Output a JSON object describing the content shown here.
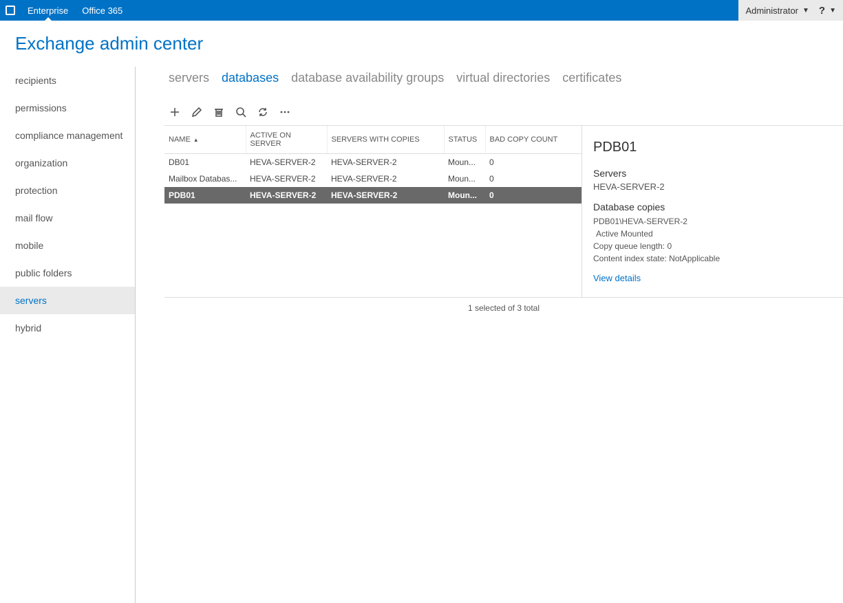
{
  "topbar": {
    "tabs": [
      {
        "label": "Enterprise",
        "active": true
      },
      {
        "label": "Office 365",
        "active": false
      }
    ],
    "user_label": "Administrator"
  },
  "page_title": "Exchange admin center",
  "sidebar": {
    "items": [
      {
        "label": "recipients",
        "active": false
      },
      {
        "label": "permissions",
        "active": false
      },
      {
        "label": "compliance management",
        "active": false
      },
      {
        "label": "organization",
        "active": false
      },
      {
        "label": "protection",
        "active": false
      },
      {
        "label": "mail flow",
        "active": false
      },
      {
        "label": "mobile",
        "active": false
      },
      {
        "label": "public folders",
        "active": false
      },
      {
        "label": "servers",
        "active": true
      },
      {
        "label": "hybrid",
        "active": false
      }
    ]
  },
  "subtabs": [
    {
      "label": "servers",
      "active": false
    },
    {
      "label": "databases",
      "active": true
    },
    {
      "label": "database availability groups",
      "active": false
    },
    {
      "label": "virtual directories",
      "active": false
    },
    {
      "label": "certificates",
      "active": false
    }
  ],
  "columns": [
    "NAME",
    "ACTIVE ON SERVER",
    "SERVERS WITH COPIES",
    "STATUS",
    "BAD COPY COUNT"
  ],
  "rows": [
    {
      "name": "DB01",
      "active_on": "HEVA-SERVER-2",
      "copies": "HEVA-SERVER-2",
      "status": "Moun...",
      "bad": "0",
      "selected": false
    },
    {
      "name": "Mailbox Databas...",
      "active_on": "HEVA-SERVER-2",
      "copies": "HEVA-SERVER-2",
      "status": "Moun...",
      "bad": "0",
      "selected": false
    },
    {
      "name": "PDB01",
      "active_on": "HEVA-SERVER-2",
      "copies": "HEVA-SERVER-2",
      "status": "Moun...",
      "bad": "0",
      "selected": true
    }
  ],
  "detail": {
    "title": "PDB01",
    "servers_label": "Servers",
    "servers_value": "HEVA-SERVER-2",
    "db_copies_label": "Database copies",
    "copy_line": "PDB01\\HEVA-SERVER-2",
    "active_line": "Active Mounted",
    "queue_label": "Copy queue length:",
    "queue_value": "0",
    "index_label": "Content index state:",
    "index_value": "NotApplicable",
    "view_details": "View details"
  },
  "footer": "1 selected of 3 total"
}
